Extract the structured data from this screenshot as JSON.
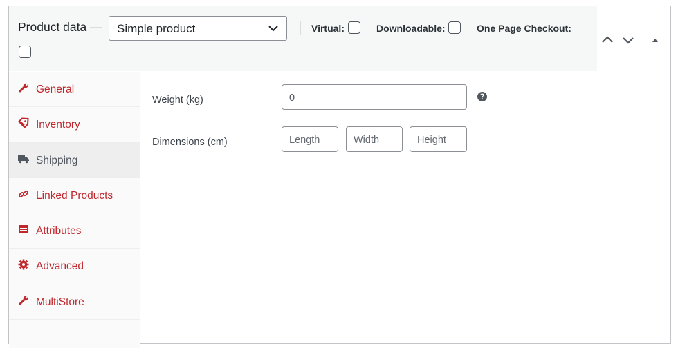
{
  "header": {
    "title": "Product data —",
    "product_type": {
      "selected": "Simple product",
      "options": [
        "Simple product"
      ]
    },
    "options": [
      {
        "label": "Virtual:",
        "checked": false
      },
      {
        "label": "Downloadable:",
        "checked": false
      },
      {
        "label": "One Page Checkout:",
        "checked": false
      }
    ],
    "controls": [
      "move-up-icon",
      "move-down-icon",
      "toggle-panel-icon"
    ]
  },
  "tabs": [
    {
      "label": "General",
      "icon": "wrench-icon",
      "active": false
    },
    {
      "label": "Inventory",
      "icon": "tag-icon",
      "active": false
    },
    {
      "label": "Shipping",
      "icon": "truck-icon",
      "active": true
    },
    {
      "label": "Linked Products",
      "icon": "link-icon",
      "active": false
    },
    {
      "label": "Attributes",
      "icon": "list-icon",
      "active": false
    },
    {
      "label": "Advanced",
      "icon": "gear-icon",
      "active": false
    },
    {
      "label": "MultiStore",
      "icon": "wrench-icon",
      "active": false
    }
  ],
  "shipping": {
    "weight": {
      "label": "Weight (kg)",
      "value": "0",
      "help": "?"
    },
    "dimensions": {
      "label": "Dimensions (cm)",
      "length_placeholder": "Length",
      "width_placeholder": "Width",
      "height_placeholder": "Height"
    }
  },
  "colors": {
    "accent": "#c0272d",
    "active_tab": "#eeeeee",
    "header_bg": "#f6f7f7"
  }
}
